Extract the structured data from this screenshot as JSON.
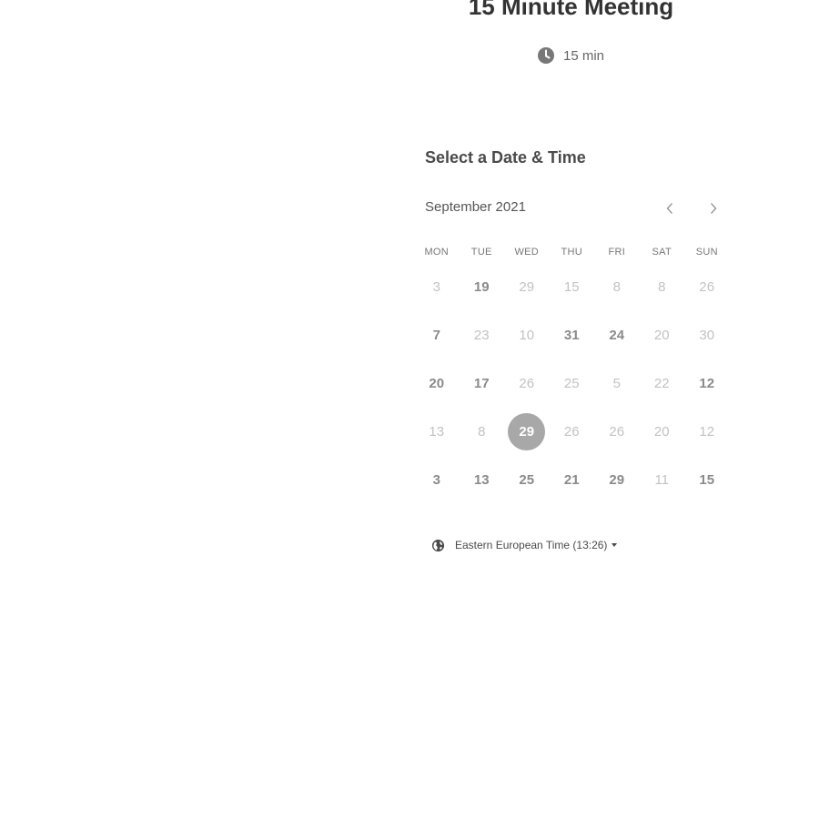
{
  "event": {
    "title": "15 Minute Meeting",
    "duration": "15 min",
    "duration_icon": "clock-icon"
  },
  "calendar": {
    "heading": "Select a Date & Time",
    "month_label": "September 2021",
    "prev_icon": "chevron-left-icon",
    "next_icon": "chevron-right-icon",
    "weekdays": [
      "MON",
      "TUE",
      "WED",
      "THU",
      "FRI",
      "SAT",
      "SUN"
    ],
    "days": [
      {
        "label": "3",
        "state": "disabled"
      },
      {
        "label": "19",
        "state": "available"
      },
      {
        "label": "29",
        "state": "disabled"
      },
      {
        "label": "15",
        "state": "disabled"
      },
      {
        "label": "8",
        "state": "disabled"
      },
      {
        "label": "8",
        "state": "disabled"
      },
      {
        "label": "26",
        "state": "disabled"
      },
      {
        "label": "7",
        "state": "available"
      },
      {
        "label": "23",
        "state": "disabled"
      },
      {
        "label": "10",
        "state": "disabled"
      },
      {
        "label": "31",
        "state": "available"
      },
      {
        "label": "24",
        "state": "available"
      },
      {
        "label": "20",
        "state": "disabled"
      },
      {
        "label": "30",
        "state": "disabled"
      },
      {
        "label": "20",
        "state": "available"
      },
      {
        "label": "17",
        "state": "available"
      },
      {
        "label": "26",
        "state": "disabled"
      },
      {
        "label": "25",
        "state": "disabled"
      },
      {
        "label": "5",
        "state": "disabled"
      },
      {
        "label": "22",
        "state": "disabled"
      },
      {
        "label": "12",
        "state": "available"
      },
      {
        "label": "13",
        "state": "disabled"
      },
      {
        "label": "8",
        "state": "disabled"
      },
      {
        "label": "29",
        "state": "selected"
      },
      {
        "label": "26",
        "state": "disabled"
      },
      {
        "label": "26",
        "state": "disabled"
      },
      {
        "label": "20",
        "state": "disabled"
      },
      {
        "label": "12",
        "state": "disabled"
      },
      {
        "label": "3",
        "state": "available"
      },
      {
        "label": "13",
        "state": "available"
      },
      {
        "label": "25",
        "state": "available"
      },
      {
        "label": "21",
        "state": "available"
      },
      {
        "label": "29",
        "state": "available"
      },
      {
        "label": "11",
        "state": "disabled"
      },
      {
        "label": "15",
        "state": "available"
      }
    ]
  },
  "timezone": {
    "label": "Eastern European Time (13:26)",
    "icon": "globe-icon"
  },
  "colors": {
    "title": "#333333",
    "available_day": "#8a8a8a",
    "disabled_day": "#c2c2c2",
    "selected_bg": "#a8a8a8",
    "selected_text": "#ffffff"
  }
}
